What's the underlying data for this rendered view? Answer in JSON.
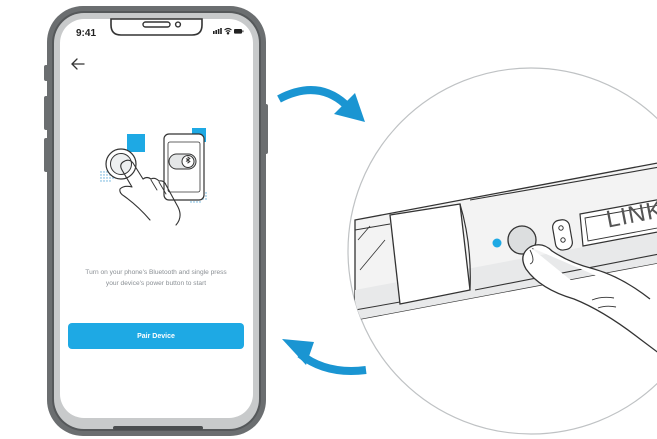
{
  "phone": {
    "status_time": "9:41",
    "instruction_line1": "Turn on your phone's Bluetooth and single press",
    "instruction_line2": "your device's power button to start",
    "pair_button_label": "Pair Device"
  },
  "device": {
    "label": "LINK"
  },
  "colors": {
    "accent": "#1ea9e4",
    "phone_frame": "#6b6e70",
    "device_body": "#f2f2f2"
  },
  "icons": [
    "back-arrow-icon",
    "signal-icon",
    "wifi-icon",
    "battery-icon",
    "bluetooth-icon",
    "hand-icon",
    "curved-arrow-icon"
  ]
}
